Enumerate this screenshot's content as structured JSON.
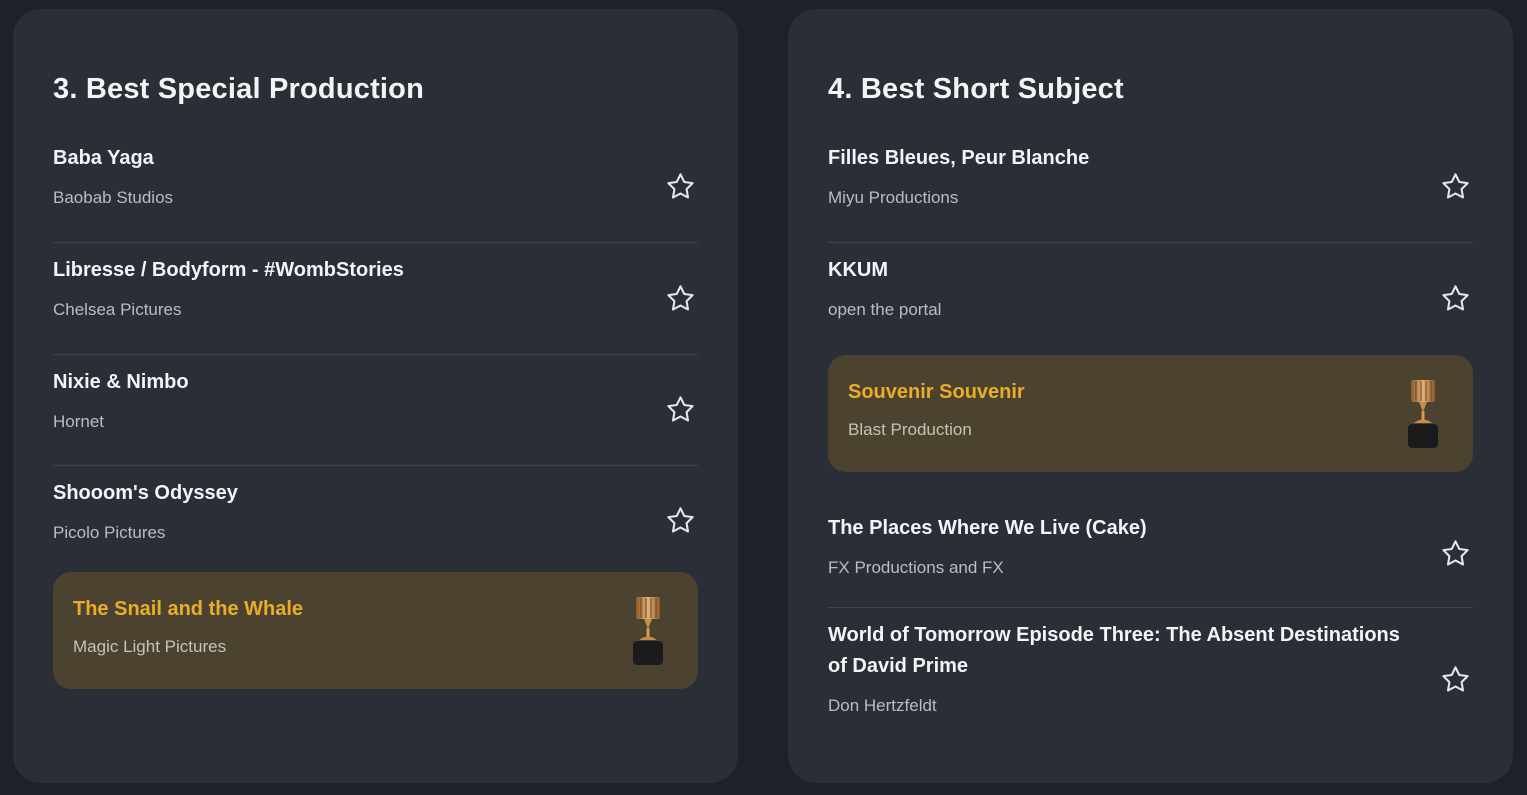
{
  "colors": {
    "background": "#1e2127",
    "card": "#2a2e36",
    "winner_bg": "#4b432f",
    "winner_text": "#eaad2a",
    "title_text": "#f3f4f6",
    "sub_text": "#b9bcc3"
  },
  "icons": {
    "favorite": "star-outline-icon",
    "winner": "trophy-icon"
  },
  "left": {
    "title": "3. Best Special Production",
    "items": [
      {
        "title": "Baba Yaga",
        "studio": "Baobab Studios"
      },
      {
        "title": "Libresse / Bodyform - #WombStories",
        "studio": "Chelsea Pictures"
      },
      {
        "title": "Nixie & Nimbo",
        "studio": "Hornet"
      },
      {
        "title": "Shooom's Odyssey",
        "studio": "Picolo Pictures"
      }
    ],
    "winner": {
      "title": "The Snail and the Whale",
      "studio": "Magic Light Pictures"
    }
  },
  "right": {
    "title": "4. Best Short Subject",
    "items": [
      {
        "title": "Filles Bleues, Peur Blanche",
        "studio": "Miyu Productions"
      },
      {
        "title": "KKUM",
        "studio": "open the portal"
      },
      {
        "title": "The Places Where We Live (Cake)",
        "studio": "FX Productions and FX"
      },
      {
        "title": "World of Tomorrow Episode Three: The Absent Destinations of David Prime",
        "studio": "Don Hertzfeldt"
      }
    ],
    "winner": {
      "title": "Souvenir Souvenir",
      "studio": "Blast Production"
    }
  }
}
